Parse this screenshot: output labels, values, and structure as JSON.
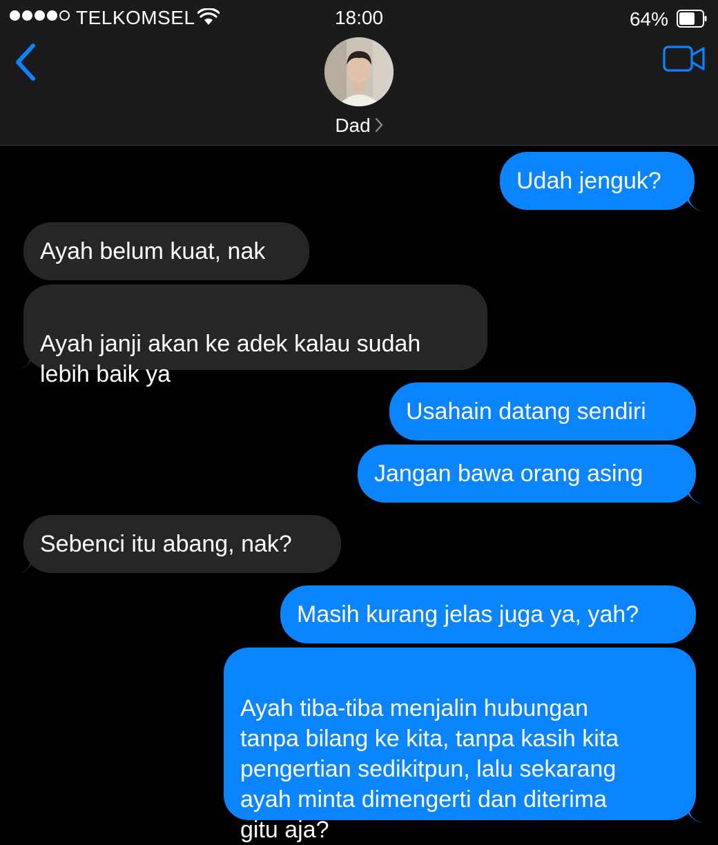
{
  "status_bar": {
    "carrier": "TELKOMSEL",
    "time": "18:00",
    "battery": "64%",
    "signal_bars": 4,
    "signal_max": 5
  },
  "nav": {
    "contact_name": "Dad",
    "back_icon": "chevron-left-icon",
    "video_icon": "video-camera-icon"
  },
  "colors": {
    "outgoing": "#0a84ff",
    "incoming": "#262628",
    "header": "#1b1b1d",
    "background": "#000000"
  },
  "messages": [
    {
      "direction": "out",
      "text": "Udah jenguk?"
    },
    {
      "direction": "in",
      "text": "Ayah belum kuat, nak"
    },
    {
      "direction": "in",
      "text": "Ayah janji akan ke adek kalau sudah\nlebih baik ya"
    },
    {
      "direction": "out",
      "text": "Usahain datang sendiri"
    },
    {
      "direction": "out",
      "text": "Jangan bawa orang asing"
    },
    {
      "direction": "in",
      "text": "Sebenci itu abang, nak?"
    },
    {
      "direction": "out",
      "text": "Masih kurang jelas juga ya, yah?"
    },
    {
      "direction": "out",
      "text": "Ayah tiba-tiba menjalin hubungan\ntanpa bilang ke kita, tanpa kasih kita\npengertian sedikitpun, lalu sekarang\nayah minta dimengerti dan diterima\ngitu aja?"
    }
  ]
}
